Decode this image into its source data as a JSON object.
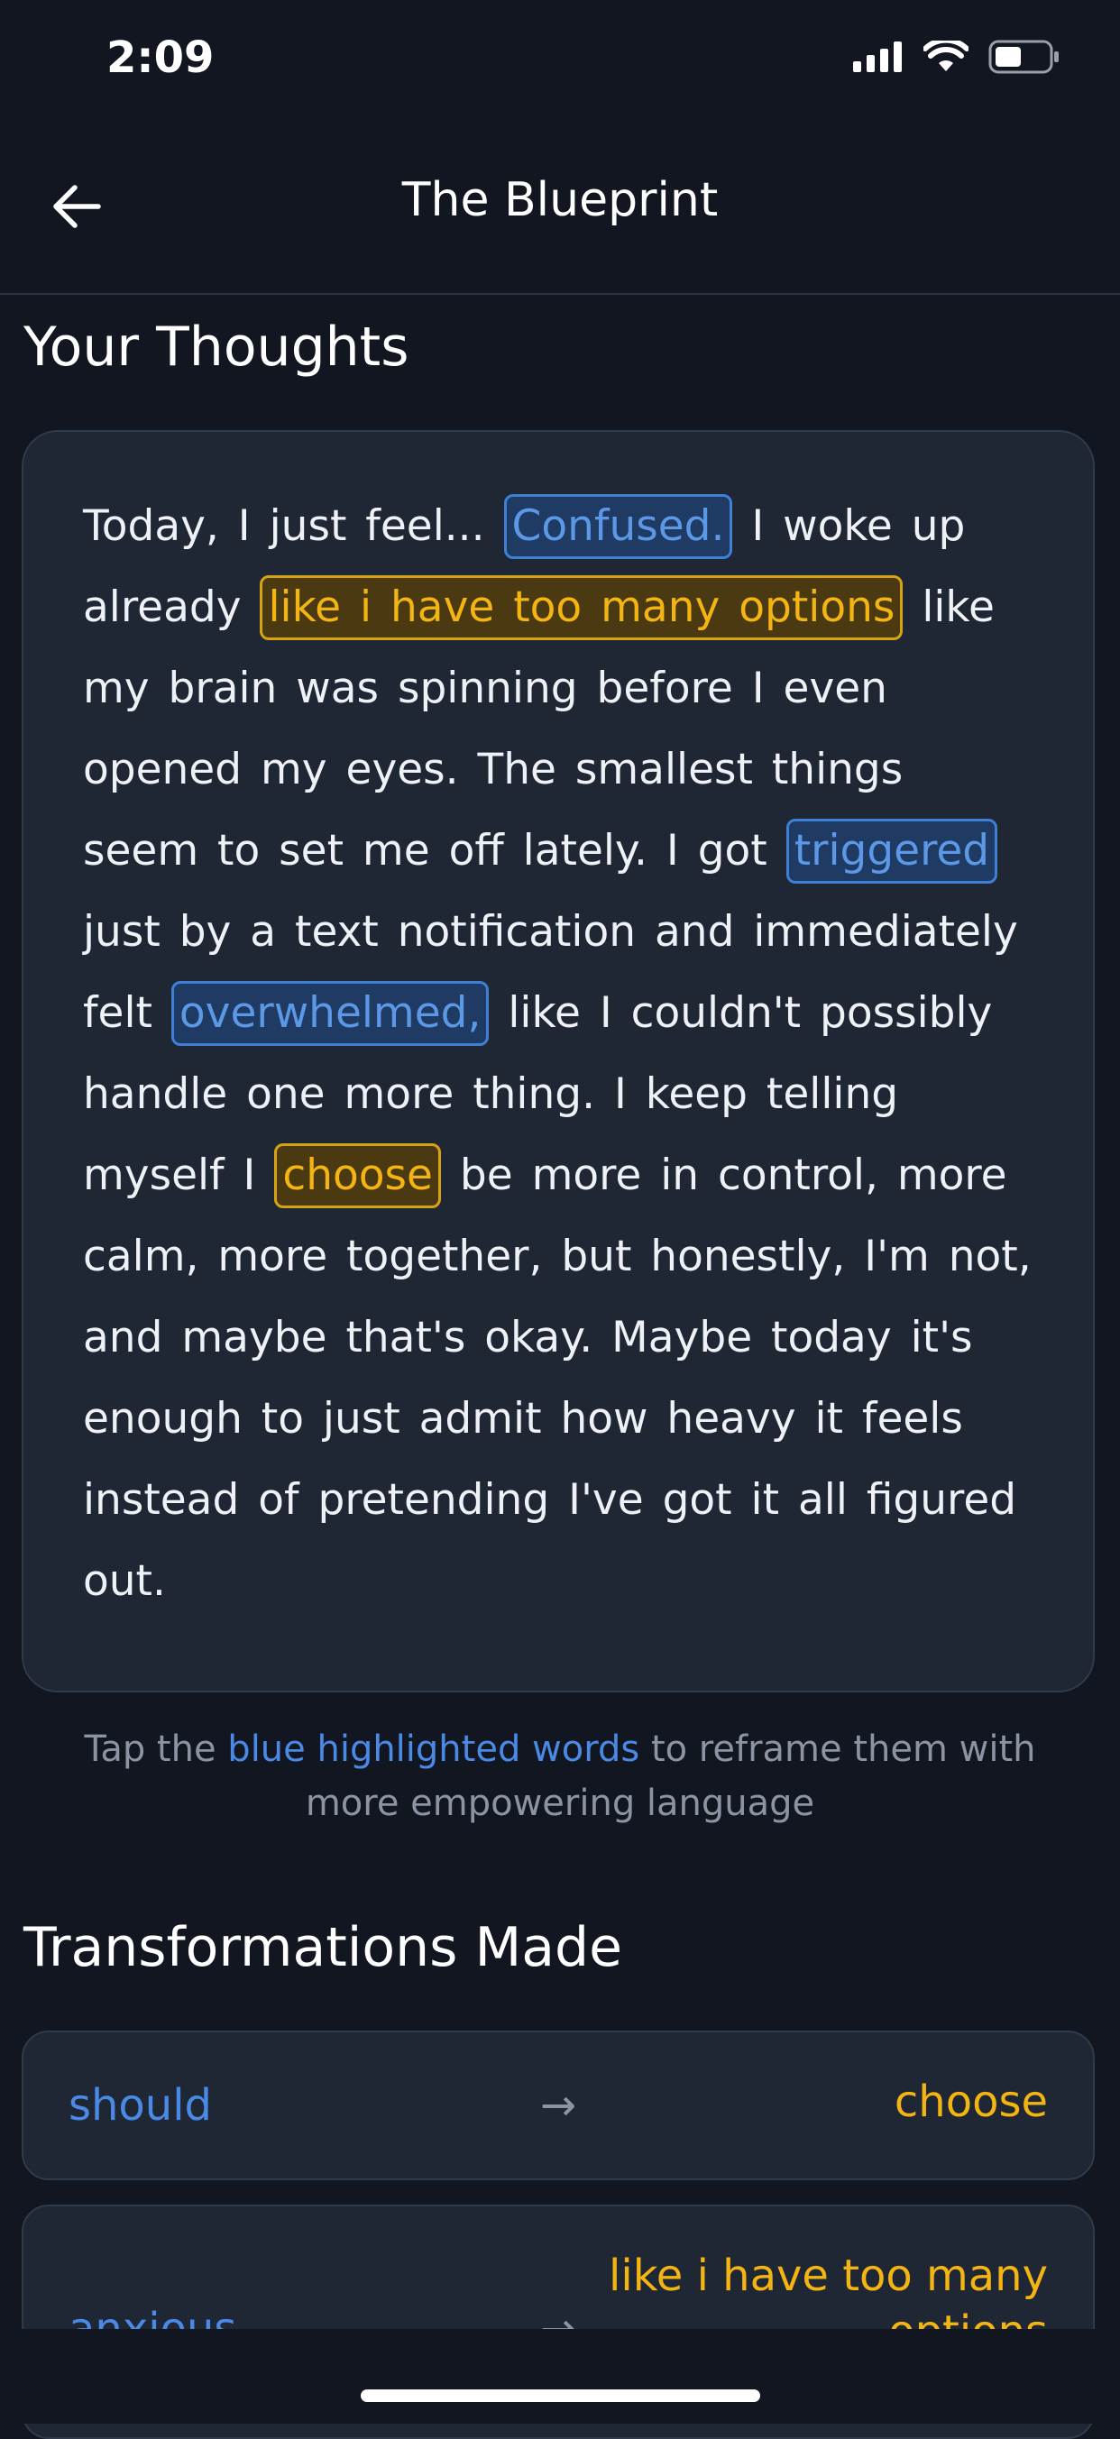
{
  "status_bar": {
    "time": "2:09"
  },
  "header": {
    "title": "The Blueprint",
    "back_icon": "arrow-left-icon"
  },
  "thoughts": {
    "title": "Your Thoughts",
    "segments": {
      "s1": "Today, I just feel...",
      "h1": "Confused.",
      "s2": "I woke up already",
      "h2": "like i have too many options",
      "s3": "like my brain was spinning before I even opened my eyes. The smallest things seem to set me off lately. I got",
      "h3": "triggered",
      "s4": "just by a text notification and immediately felt",
      "h4": "overwhelmed,",
      "s5": "like I couldn't possibly handle one more thing. I keep telling myself I",
      "h5": "choose",
      "s6": "be more in control, more calm, more together, but honestly, I'm not, and maybe that's okay. Maybe today it's enough to just admit how heavy it feels instead of pretending I've got it all figured out."
    }
  },
  "hint": {
    "prefix": "Tap the",
    "link": "blue highlighted words",
    "suffix": "to reframe them with more empowering language"
  },
  "transformations": {
    "title": "Transformations Made",
    "items": [
      {
        "from": "should",
        "arrow": "→",
        "to": "choose"
      },
      {
        "from": "anxious",
        "arrow": "→",
        "to": "like i have too many options"
      }
    ]
  },
  "colors": {
    "background": "#121620",
    "card": "#1f2735",
    "blue_highlight": "#5b98e6",
    "yellow_highlight": "#f4b513"
  }
}
